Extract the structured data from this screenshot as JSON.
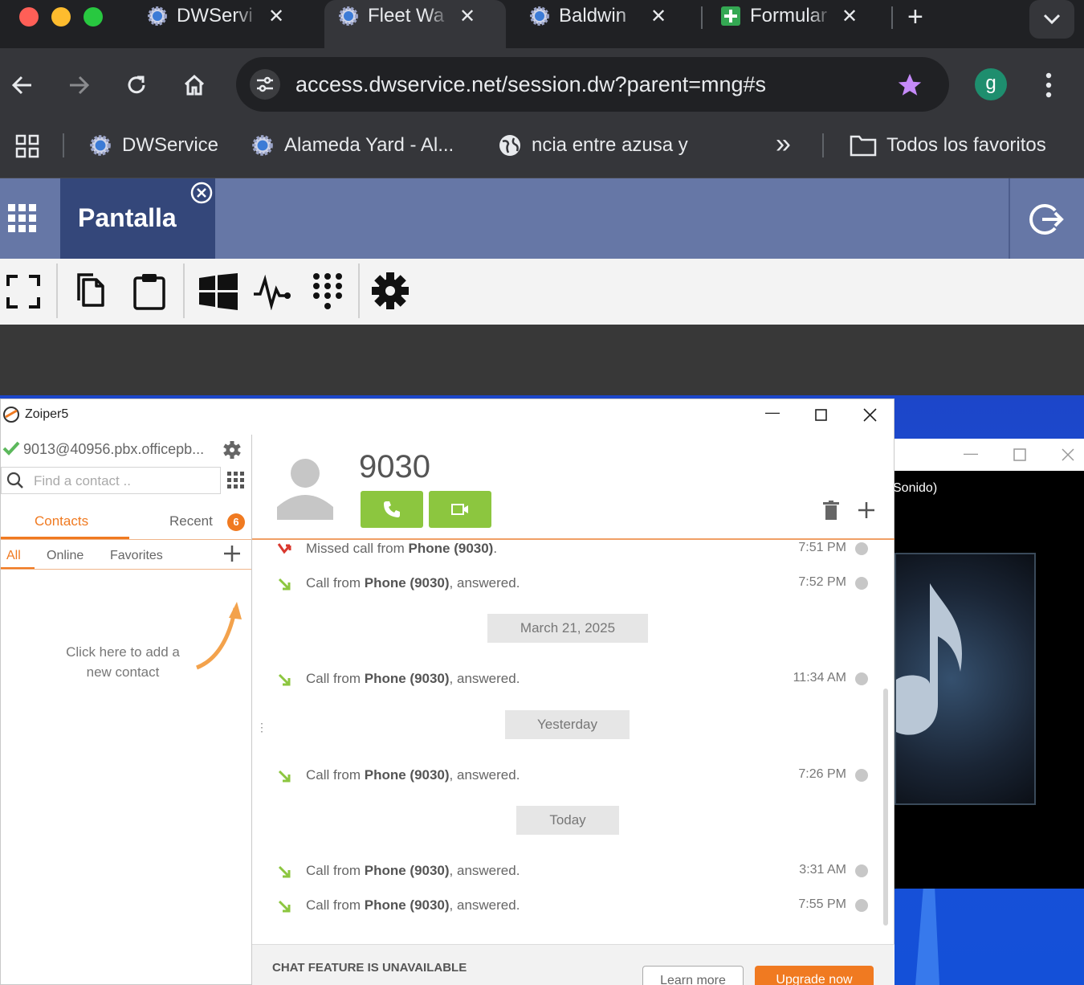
{
  "browser": {
    "tabs": [
      {
        "title": "DWServi",
        "icon": "dwservice-gear-icon"
      },
      {
        "title": "Fleet Wa",
        "icon": "dwservice-gear-icon",
        "active": true
      },
      {
        "title": "Baldwin",
        "icon": "dwservice-gear-icon"
      },
      {
        "title": "Formular",
        "icon": "google-forms-icon"
      }
    ],
    "new_tab_label": "+",
    "url": "access.dwservice.net/session.dw?parent=mng#s",
    "profile_initial": "g",
    "bookmarks": [
      {
        "label": "DWService",
        "icon": "dwservice-gear-icon"
      },
      {
        "label": "Alameda Yard - Al...",
        "icon": "dwservice-gear-icon"
      },
      {
        "label": "ncia entre azusa y",
        "icon": "globe-icon"
      }
    ],
    "overflow_label": "»",
    "all_bookmarks_label": "Todos los favoritos",
    "colors": {
      "tabstrip": "#202124",
      "toolbar": "#35363a",
      "star": "#c58af9"
    }
  },
  "dwservice": {
    "active_tab": "Pantalla",
    "header_color": "#6677a6",
    "tab_color": "#34477a"
  },
  "zoiper": {
    "app_title": "Zoiper5",
    "account": "9013@40956.pbx.officepb...",
    "search_placeholder": "Find a contact ..",
    "tabs": {
      "contacts": "Contacts",
      "recent": "Recent",
      "recent_badge": "6"
    },
    "filters": {
      "all": "All",
      "online": "Online",
      "favorites": "Favorites"
    },
    "add_contact_hint": [
      "Click here to add a",
      "new contact"
    ],
    "contact_name": "9030",
    "history": [
      {
        "type": "missed",
        "prefix": "Missed call from ",
        "who": "Phone (9030)",
        "suffix": ".",
        "time": "7:51 PM"
      },
      {
        "type": "answered",
        "prefix": "Call from ",
        "who": "Phone (9030)",
        "suffix": ", answered.",
        "time": "7:52 PM"
      },
      {
        "type": "date",
        "label": "March 21, 2025"
      },
      {
        "type": "answered",
        "prefix": "Call from ",
        "who": "Phone (9030)",
        "suffix": ", answered.",
        "time": "11:34 AM"
      },
      {
        "type": "date",
        "label": "Yesterday"
      },
      {
        "type": "answered",
        "prefix": "Call from ",
        "who": "Phone (9030)",
        "suffix": ", answered.",
        "time": "7:26 PM"
      },
      {
        "type": "date",
        "label": "Today"
      },
      {
        "type": "answered",
        "prefix": "Call from ",
        "who": "Phone (9030)",
        "suffix": ", answered.",
        "time": "3:31 AM"
      },
      {
        "type": "answered",
        "prefix": "Call from ",
        "who": "Phone (9030)",
        "suffix": ", answered.",
        "time": "7:55 PM"
      }
    ],
    "chat_unavailable": "CHAT FEATURE IS UNAVAILABLE",
    "learn_more": "Learn more",
    "upgrade_now": "Upgrade now",
    "colors": {
      "accent": "#f07a21",
      "call_green": "#8cc63f"
    }
  },
  "media_player": {
    "title_fragment": "Sonido)"
  }
}
